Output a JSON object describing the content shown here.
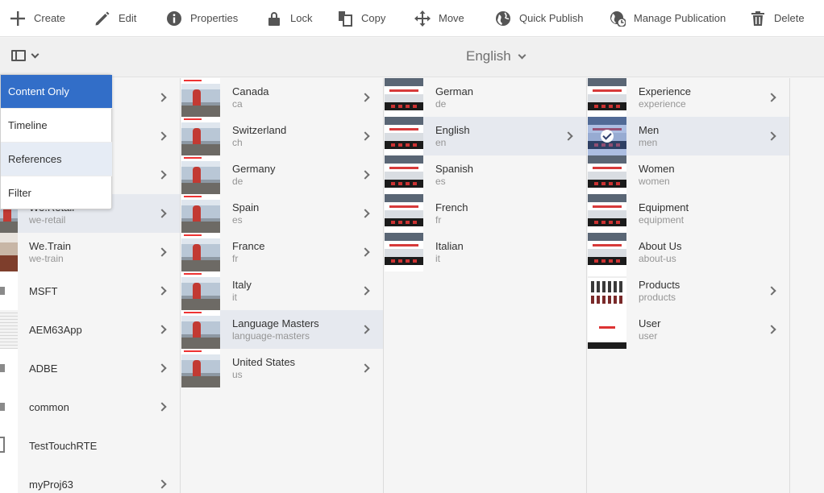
{
  "toolbar": {
    "create": "Create",
    "edit": "Edit",
    "properties": "Properties",
    "lock": "Lock",
    "copy": "Copy",
    "move": "Move",
    "quick_publish": "Quick Publish",
    "manage_publication": "Manage Publication",
    "delete": "Delete"
  },
  "header": {
    "title": "English"
  },
  "view_menu": {
    "items": [
      "Content Only",
      "Timeline",
      "References",
      "Filter"
    ],
    "selected": "Content Only",
    "hovered": "References"
  },
  "columns": {
    "sites": [
      {
        "title": "",
        "sub": ""
      },
      {
        "title": "",
        "sub": ""
      },
      {
        "title": "",
        "sub": ""
      },
      {
        "title": "We.Retail",
        "sub": "we-retail"
      },
      {
        "title": "We.Train",
        "sub": "we-train"
      },
      {
        "title": "MSFT",
        "sub": ""
      },
      {
        "title": "AEM63App",
        "sub": ""
      },
      {
        "title": "ADBE",
        "sub": ""
      },
      {
        "title": "common",
        "sub": ""
      },
      {
        "title": "TestTouchRTE",
        "sub": ""
      },
      {
        "title": "myProj63",
        "sub": ""
      }
    ],
    "countries": [
      {
        "title": "Canada",
        "sub": "ca"
      },
      {
        "title": "Switzerland",
        "sub": "ch"
      },
      {
        "title": "Germany",
        "sub": "de"
      },
      {
        "title": "Spain",
        "sub": "es"
      },
      {
        "title": "France",
        "sub": "fr"
      },
      {
        "title": "Italy",
        "sub": "it"
      },
      {
        "title": "Language Masters",
        "sub": "language-masters"
      },
      {
        "title": "United States",
        "sub": "us"
      }
    ],
    "languages": [
      {
        "title": "German",
        "sub": "de"
      },
      {
        "title": "English",
        "sub": "en"
      },
      {
        "title": "Spanish",
        "sub": "es"
      },
      {
        "title": "French",
        "sub": "fr"
      },
      {
        "title": "Italian",
        "sub": "it"
      }
    ],
    "pages": [
      {
        "title": "Experience",
        "sub": "experience"
      },
      {
        "title": "Men",
        "sub": "men"
      },
      {
        "title": "Women",
        "sub": "women"
      },
      {
        "title": "Equipment",
        "sub": "equipment"
      },
      {
        "title": "About Us",
        "sub": "about-us"
      },
      {
        "title": "Products",
        "sub": "products"
      },
      {
        "title": "User",
        "sub": "user"
      }
    ]
  },
  "colors": {
    "accent": "#326ec8",
    "active_row": "#e6e9ef"
  }
}
